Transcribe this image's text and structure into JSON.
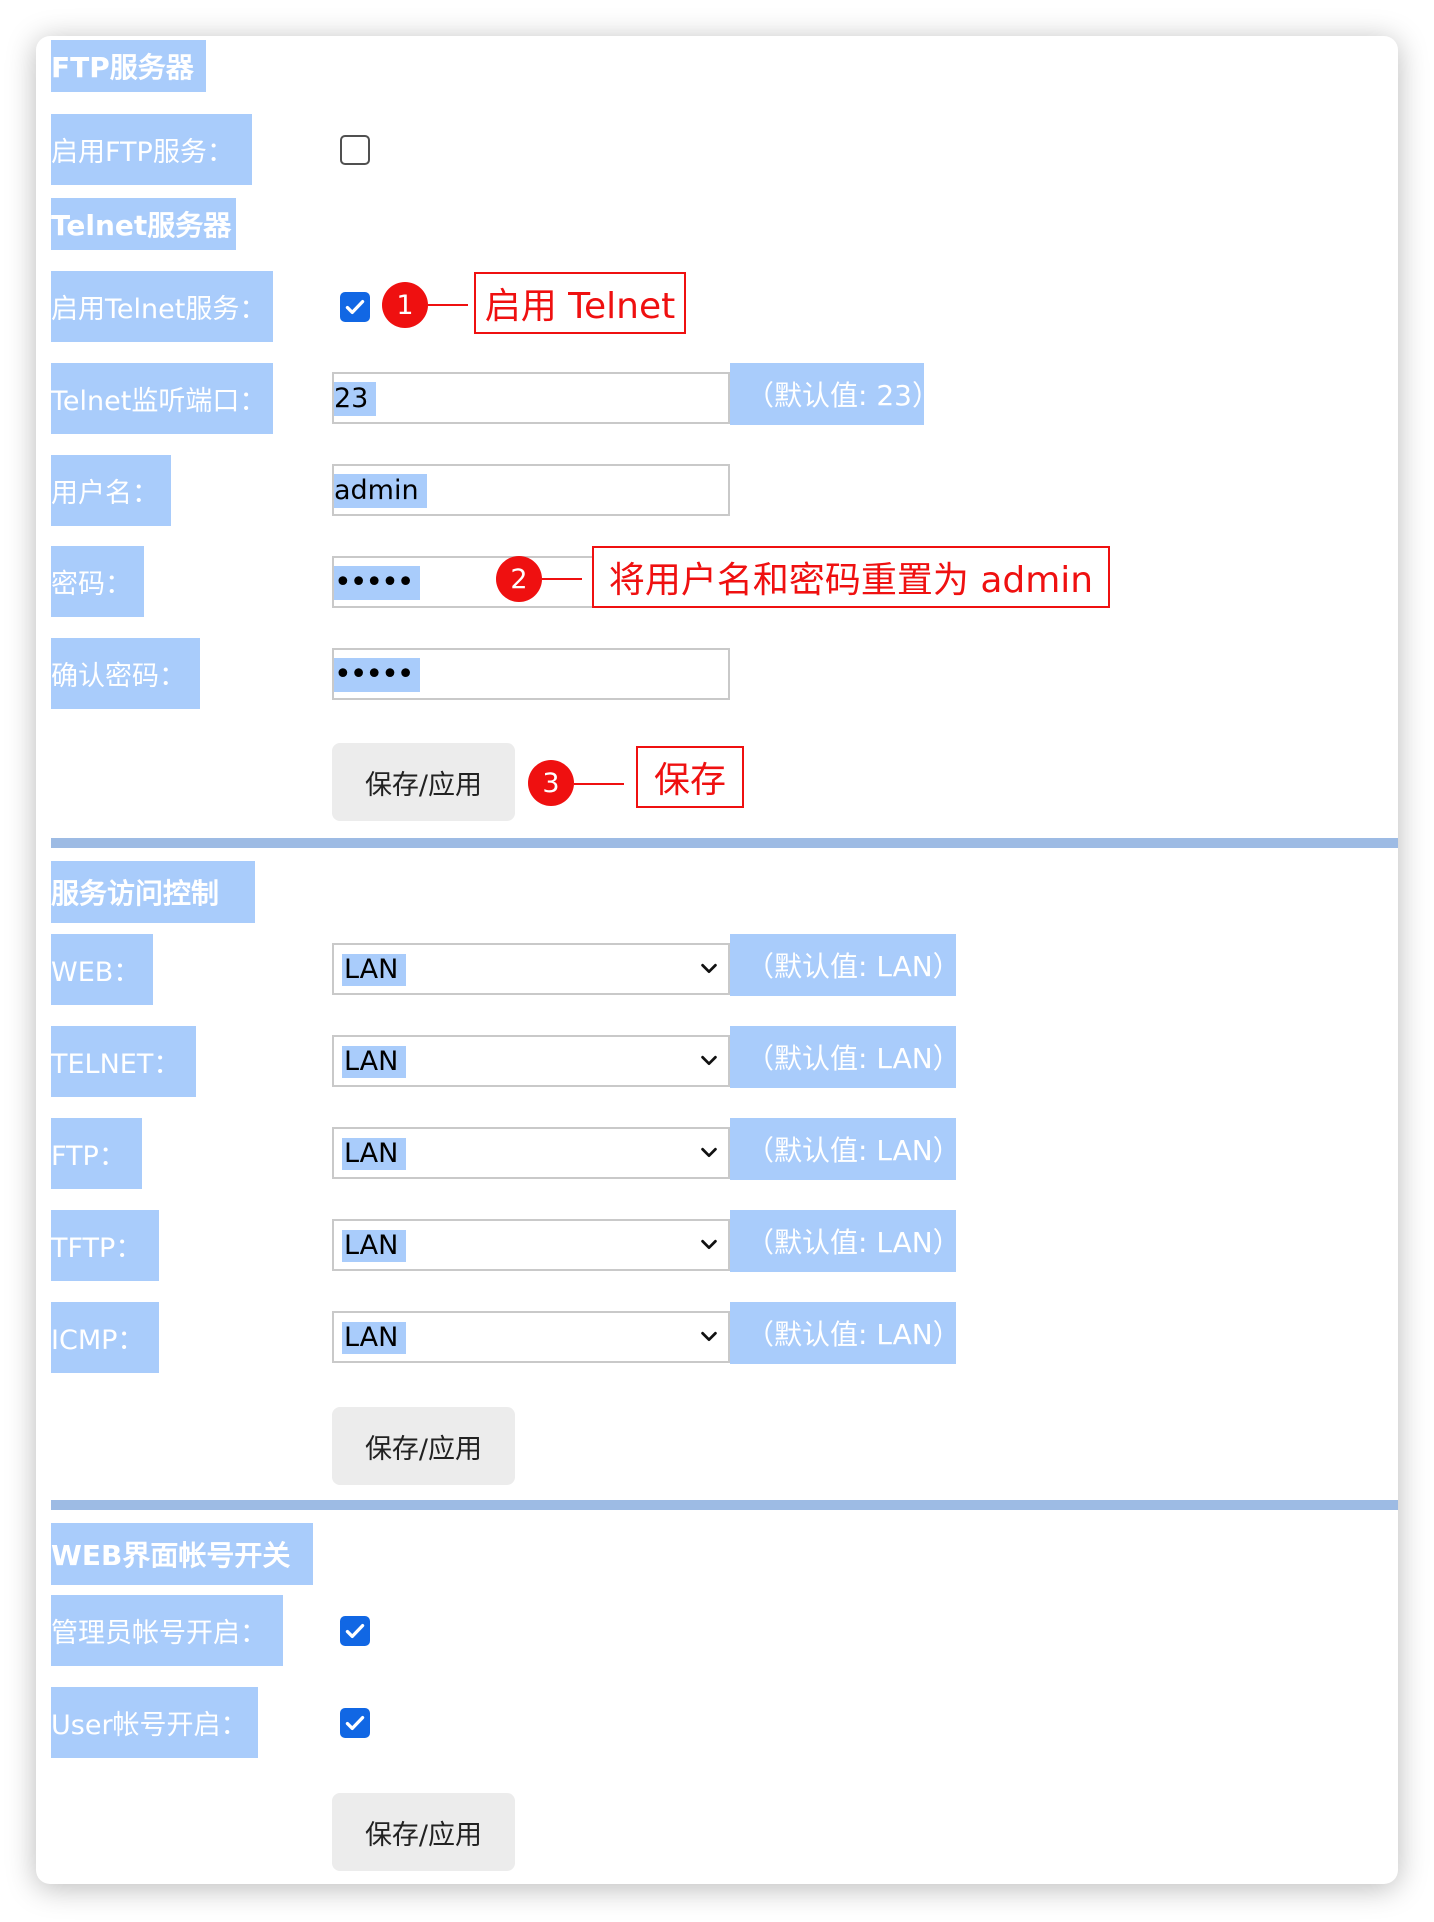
{
  "ftp": {
    "section_title": "FTP服务器",
    "enable_label": "启用FTP服务：",
    "enabled": false
  },
  "telnet": {
    "section_title": "Telnet服务器",
    "enable_label": "启用Telnet服务：",
    "enabled": true,
    "port_label": "Telnet监听端口：",
    "port_value": "23",
    "port_hint": "（默认值: 23）",
    "username_label": "用户名：",
    "username_value": "admin",
    "password_label": "密码：",
    "password_value": "•••••",
    "confirm_label": "确认密码：",
    "confirm_value": "•••••",
    "save_button": "保存/应用"
  },
  "access_control": {
    "section_title": "服务访问控制",
    "rows": [
      {
        "label": "WEB：",
        "value": "LAN",
        "hint": "（默认值: LAN）"
      },
      {
        "label": "TELNET：",
        "value": "LAN",
        "hint": "（默认值: LAN）"
      },
      {
        "label": "FTP：",
        "value": "LAN",
        "hint": "（默认值: LAN）"
      },
      {
        "label": "TFTP：",
        "value": "LAN",
        "hint": "（默认值: LAN）"
      },
      {
        "label": "ICMP：",
        "value": "LAN",
        "hint": "（默认值: LAN）"
      }
    ],
    "save_button": "保存/应用"
  },
  "web_account": {
    "section_title": "WEB界面帐号开关",
    "admin_label": "管理员帐号开启：",
    "admin_enabled": true,
    "user_label": "User帐号开启：",
    "user_enabled": true,
    "save_button": "保存/应用"
  },
  "annotations": [
    {
      "number": "1",
      "text": "启用 Telnet"
    },
    {
      "number": "2",
      "text": "将用户名和密码重置为 admin"
    },
    {
      "number": "3",
      "text": "保存"
    }
  ],
  "colors": {
    "highlight": "#a9ccfb",
    "checkbox_checked": "#1167e4",
    "annotation_red": "#ef1010",
    "separator": "#9dbbe4"
  },
  "icons": {
    "checkmark": "checkmark-icon",
    "select_arrow": "chevron-down-icon"
  }
}
